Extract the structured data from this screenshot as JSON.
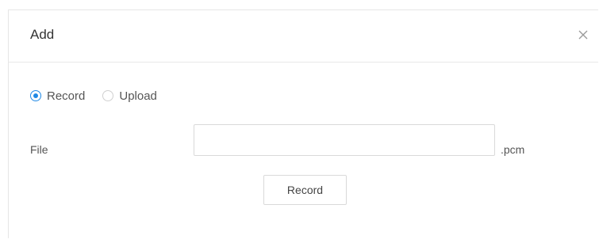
{
  "dialog": {
    "title": "Add",
    "close_icon": "close-icon"
  },
  "source_options": [
    {
      "label": "Record",
      "selected": true
    },
    {
      "label": "Upload",
      "selected": false
    }
  ],
  "file_field": {
    "label": "File",
    "value": "",
    "placeholder": "",
    "extension": ".pcm"
  },
  "actions": {
    "record_label": "Record"
  },
  "colors": {
    "accent": "#1e88e5",
    "border": "#d9d9d9",
    "text": "#555555"
  }
}
